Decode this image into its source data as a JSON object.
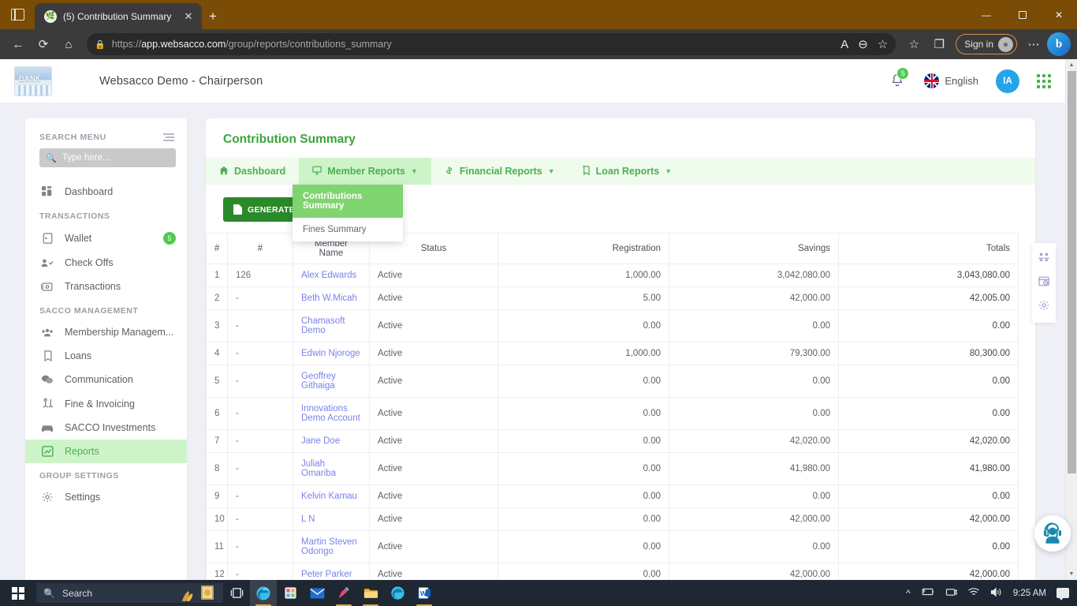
{
  "browser": {
    "tab_title": "(5) Contribution Summary",
    "tab_favicon": "leaf-icon",
    "new_tab_label": "+",
    "url_prefix": "https://",
    "url_domain": "app.websacco.com",
    "url_path": "/group/reports/contributions_summary",
    "signin_label": "Sign in",
    "minimize_label": "—",
    "maximize_label": "❐",
    "close_label": "✕",
    "back_label": "←",
    "refresh_label": "⟳",
    "home_label": "⌂",
    "read_aloud_label": "A",
    "zoom_label": "⊖",
    "favorites_label": "☆",
    "collections_label": "❐",
    "settings_label": "⋯",
    "copilot_label": "b"
  },
  "app_header": {
    "title": "Websacco Demo - Chairperson",
    "logo_text": "BANK",
    "notification_count": "5",
    "language": "English",
    "user_initials": "IA"
  },
  "sidebar": {
    "search_header": "SEARCH MENU",
    "search_placeholder": "Type here...",
    "groups": [
      {
        "label": "",
        "items": [
          {
            "label": "Dashboard",
            "icon": "dashboard-icon",
            "badge": "",
            "active": false
          }
        ]
      },
      {
        "label": "TRANSACTIONS",
        "items": [
          {
            "label": "Wallet",
            "icon": "wallet-icon",
            "badge": "5",
            "active": false
          },
          {
            "label": "Check Offs",
            "icon": "check-offs-icon",
            "badge": "",
            "active": false
          },
          {
            "label": "Transactions",
            "icon": "transactions-icon",
            "badge": "",
            "active": false
          }
        ]
      },
      {
        "label": "SACCO MANAGEMENT",
        "items": [
          {
            "label": "Membership Managem...",
            "icon": "members-icon",
            "badge": "",
            "active": false
          },
          {
            "label": "Loans",
            "icon": "loans-icon",
            "badge": "",
            "active": false
          },
          {
            "label": "Communication",
            "icon": "communication-icon",
            "badge": "",
            "active": false
          },
          {
            "label": "Fine & Invoicing",
            "icon": "fine-invoicing-icon",
            "badge": "",
            "active": false
          },
          {
            "label": "SACCO Investments",
            "icon": "investments-icon",
            "badge": "",
            "active": false
          },
          {
            "label": "Reports",
            "icon": "reports-icon",
            "badge": "",
            "active": true
          }
        ]
      },
      {
        "label": "GROUP SETTINGS",
        "items": [
          {
            "label": "Settings",
            "icon": "gear-icon",
            "badge": "",
            "active": false
          }
        ]
      }
    ]
  },
  "main": {
    "page_title": "Contribution Summary",
    "tabs": [
      {
        "label": "Dashboard",
        "icon": "home-icon",
        "caret": false,
        "selected": false
      },
      {
        "label": "Member Reports",
        "icon": "monitor-icon",
        "caret": true,
        "selected": true
      },
      {
        "label": "Financial Reports",
        "icon": "finance-icon",
        "caret": true,
        "selected": false
      },
      {
        "label": "Loan Reports",
        "icon": "loan-icon",
        "caret": true,
        "selected": false
      }
    ],
    "dropdown": {
      "items": [
        {
          "label": "Contributions Summary",
          "selected": true
        },
        {
          "label": "Fines Summary",
          "selected": false
        }
      ]
    },
    "generate_excel_label": "GENERATE EXCEL",
    "table": {
      "columns": [
        "#",
        "#",
        "Member Name",
        "Status",
        "Registration",
        "Savings",
        "Totals"
      ],
      "rows": [
        {
          "idx": "1",
          "num": "126",
          "name": "Alex Edwards",
          "status": "Active",
          "registration": "1,000.00",
          "savings": "3,042,080.00",
          "totals": "3,043,080.00"
        },
        {
          "idx": "2",
          "num": "-",
          "name": "Beth W.Micah",
          "status": "Active",
          "registration": "5.00",
          "savings": "42,000.00",
          "totals": "42,005.00"
        },
        {
          "idx": "3",
          "num": "-",
          "name": "Chamasoft Demo",
          "status": "Active",
          "registration": "0.00",
          "savings": "0.00",
          "totals": "0.00"
        },
        {
          "idx": "4",
          "num": "-",
          "name": "Edwin Njoroge",
          "status": "Active",
          "registration": "1,000.00",
          "savings": "79,300.00",
          "totals": "80,300.00"
        },
        {
          "idx": "5",
          "num": "-",
          "name": "Geoffrey Githaiga",
          "status": "Active",
          "registration": "0.00",
          "savings": "0.00",
          "totals": "0.00"
        },
        {
          "idx": "6",
          "num": "-",
          "name": "Innovations Demo Account",
          "status": "Active",
          "registration": "0.00",
          "savings": "0.00",
          "totals": "0.00"
        },
        {
          "idx": "7",
          "num": "-",
          "name": "Jane Doe",
          "status": "Active",
          "registration": "0.00",
          "savings": "42,020.00",
          "totals": "42,020.00"
        },
        {
          "idx": "8",
          "num": "-",
          "name": "Juliah Omariba",
          "status": "Active",
          "registration": "0.00",
          "savings": "41,980.00",
          "totals": "41,980.00"
        },
        {
          "idx": "9",
          "num": "-",
          "name": "Kelvin Kamau",
          "status": "Active",
          "registration": "0.00",
          "savings": "0.00",
          "totals": "0.00"
        },
        {
          "idx": "10",
          "num": "-",
          "name": "L N",
          "status": "Active",
          "registration": "0.00",
          "savings": "42,000.00",
          "totals": "42,000.00"
        },
        {
          "idx": "11",
          "num": "-",
          "name": "Martin Steven Odongo",
          "status": "Active",
          "registration": "0.00",
          "savings": "0.00",
          "totals": "0.00"
        },
        {
          "idx": "12",
          "num": "-",
          "name": "Peter Parker",
          "status": "Active",
          "registration": "0.00",
          "savings": "42,000.00",
          "totals": "42,000.00"
        }
      ]
    },
    "rail_icons": [
      "members-rail-icon",
      "calendar-clock-rail-icon",
      "gear-rail-icon"
    ],
    "chat_widget": "support-agent-icon"
  },
  "taskbar": {
    "search_placeholder": "Search",
    "clock": "9:25 AM",
    "apps": [
      "task-view",
      "edge",
      "store",
      "mail",
      "paint",
      "file-explorer",
      "edge-2",
      "word"
    ]
  },
  "colors": {
    "accent_green": "#4caf50",
    "tab_bar_green": "#effbec",
    "selected_green": "#cdf4c8",
    "excel_green": "#2a8a2a",
    "link_purple": "#7b82e8",
    "badge_green": "#4ecb4e",
    "avatar_blue": "#26a4e8",
    "titlebar_brown": "#7a4c05"
  }
}
